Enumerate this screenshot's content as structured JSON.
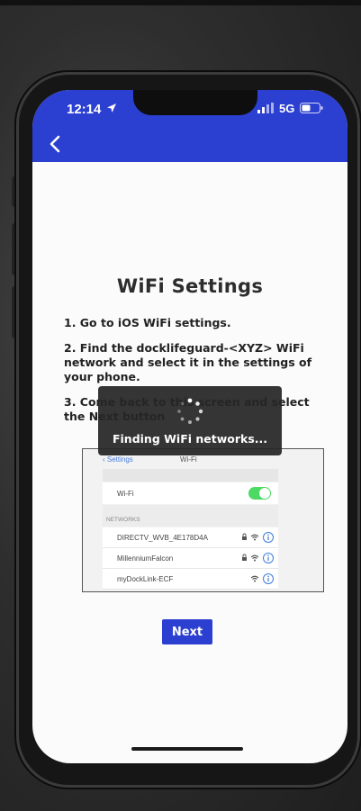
{
  "status_bar": {
    "time": "12:14",
    "network": "5G",
    "icons": [
      "location-arrow-icon",
      "signal-icon",
      "battery-icon"
    ]
  },
  "header": {
    "back_icon": "chevron-left-icon",
    "color": "#2b3fd1"
  },
  "page": {
    "title": "WiFi Settings",
    "steps": [
      "1. Go to iOS WiFi settings.",
      "2. Find the docklifeguard-<XYZ> WiFi network and select it in the settings of your phone.",
      "3. Come back to this screen and select the Next button"
    ],
    "next_label": "Next"
  },
  "ios_screenshot": {
    "back_label": "Settings",
    "title": "Wi-Fi",
    "wifi_label": "Wi-Fi",
    "wifi_enabled": true,
    "networks_header": "NETWORKS",
    "networks": [
      {
        "name": "DIRECTV_WVB_4E178D4A",
        "locked": true
      },
      {
        "name": "MillenniumFalcon",
        "locked": true
      },
      {
        "name": "myDockLink-ECF",
        "locked": false
      }
    ]
  },
  "loading_overlay": {
    "message": "Finding WiFi networks..."
  },
  "colors": {
    "accent": "#2b3fd1",
    "toggle_on": "#4cd964",
    "overlay": "#262626"
  }
}
